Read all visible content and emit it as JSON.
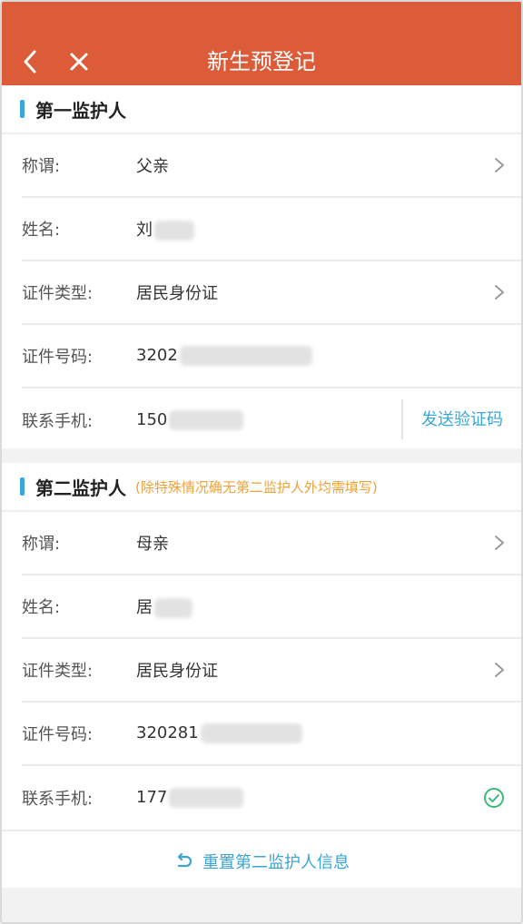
{
  "header": {
    "title": "新生预登记",
    "back_icon": "chevron-left-icon",
    "close_icon": "close-icon",
    "bg_color": "#dc5b38"
  },
  "guardian1": {
    "title": "第一监护人",
    "rows": {
      "relation": {
        "label": "称谓:",
        "value": "父亲"
      },
      "name": {
        "label": "姓名:",
        "value": "刘"
      },
      "id_type": {
        "label": "证件类型:",
        "value": "居民身份证"
      },
      "id_number": {
        "label": "证件号码:",
        "value": "3202"
      },
      "phone": {
        "label": "联系手机:",
        "value": "150"
      }
    },
    "send_code": "发送验证码"
  },
  "guardian2": {
    "title": "第二监护人",
    "note": "(除特殊情况确无第二监护人外均需填写)",
    "rows": {
      "relation": {
        "label": "称谓:",
        "value": "母亲"
      },
      "name": {
        "label": "姓名:",
        "value": "居"
      },
      "id_type": {
        "label": "证件类型:",
        "value": "居民身份证"
      },
      "id_number": {
        "label": "证件号码:",
        "value": "320281"
      },
      "phone": {
        "label": "联系手机:",
        "value": "177"
      }
    },
    "verified_icon": "check-circle-icon",
    "reset": "重置第二监护人信息",
    "reset_icon": "undo-icon"
  },
  "colors": {
    "accent": "#3aa5d6",
    "note": "#f0a23a",
    "verified": "#3cb878"
  }
}
